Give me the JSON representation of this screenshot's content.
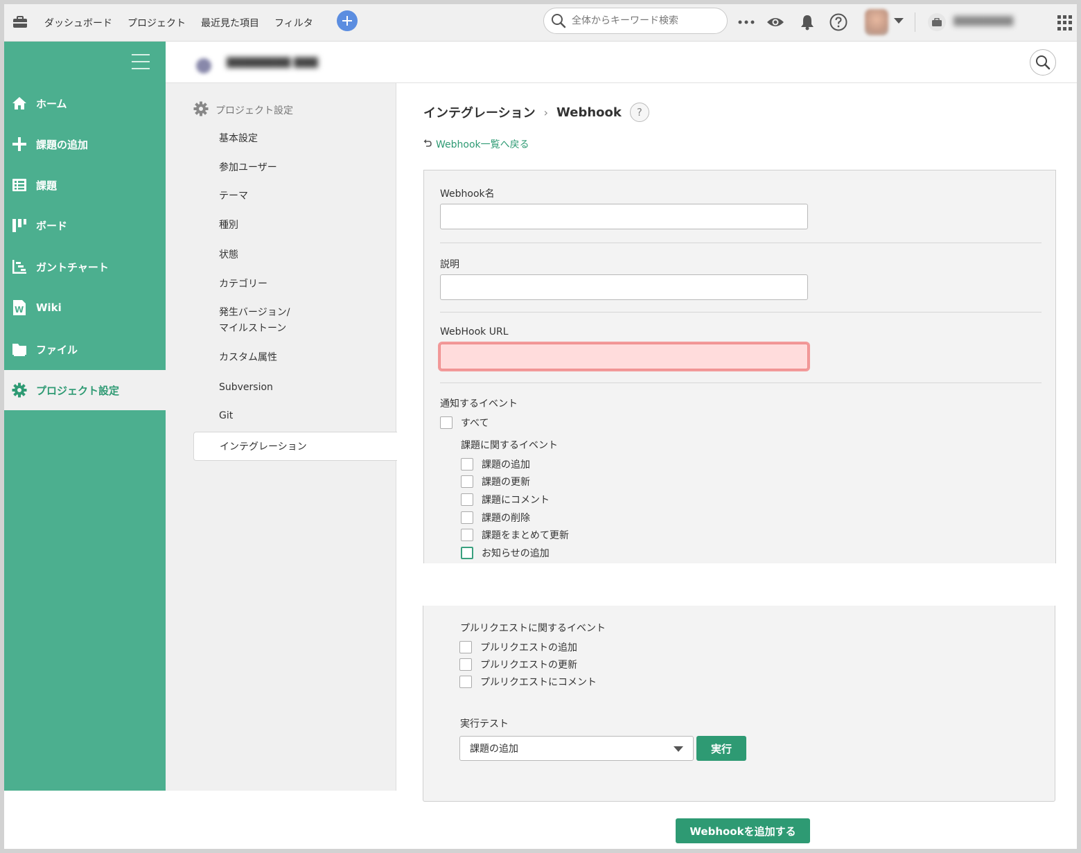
{
  "topbar": {
    "nav": [
      "ダッシュボード",
      "プロジェクト",
      "最近見た項目",
      "フィルタ"
    ],
    "search_placeholder": "全体からキーワード検索"
  },
  "leftnav": {
    "items": [
      {
        "label": "ホーム",
        "icon": "home-icon"
      },
      {
        "label": "課題の追加",
        "icon": "plus-icon"
      },
      {
        "label": "課題",
        "icon": "list-icon"
      },
      {
        "label": "ボード",
        "icon": "board-icon"
      },
      {
        "label": "ガントチャート",
        "icon": "gantt-icon"
      },
      {
        "label": "Wiki",
        "icon": "wiki-icon"
      },
      {
        "label": "ファイル",
        "icon": "file-icon"
      },
      {
        "label": "プロジェクト設定",
        "icon": "gear-icon",
        "active": true
      }
    ]
  },
  "settings_nav": {
    "title": "プロジェクト設定",
    "items": [
      "基本設定",
      "参加ユーザー",
      "テーマ",
      "種別",
      "状態",
      "カテゴリー",
      "発生バージョン/",
      "マイルストーン",
      "カスタム属性",
      "Subversion",
      "Git"
    ],
    "active": "インテグレーション"
  },
  "main": {
    "breadcrumb": {
      "parent": "インテグレーション",
      "current": "Webhook",
      "help": "?"
    },
    "back_link": "Webhook一覧へ戻る",
    "form": {
      "name_label": "Webhook名",
      "name_value": "",
      "desc_label": "説明",
      "desc_value": "",
      "url_label": "WebHook URL",
      "url_value": "",
      "events_label": "通知するイベント",
      "all_label": "すべて",
      "issue_events_label": "課題に関するイベント",
      "issue_events": [
        "課題の追加",
        "課題の更新",
        "課題にコメント",
        "課題の削除",
        "課題をまとめて更新",
        "お知らせの追加"
      ],
      "pr_events_label": "プルリクエストに関するイベント",
      "pr_events": [
        "プルリクエストの追加",
        "プルリクエストの更新",
        "プルリクエストにコメント"
      ],
      "test_label": "実行テスト",
      "test_selected": "課題の追加",
      "run_button": "実行",
      "submit_button": "Webhookを追加する"
    }
  },
  "colors": {
    "accent": "#4caf8f",
    "accent_dark": "#2e9a73",
    "error_bg": "#ffdcdc",
    "error_border": "#f29a9a",
    "plus_button": "#5b8de0"
  }
}
